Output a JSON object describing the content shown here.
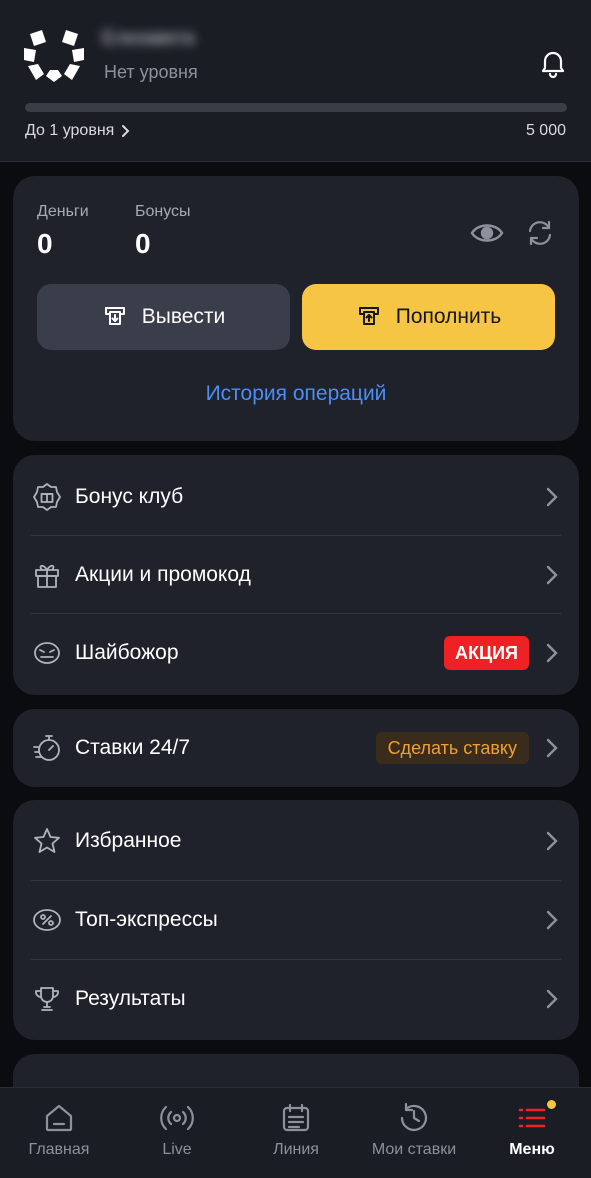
{
  "header": {
    "username": "Елизавета",
    "level_name": "Нет уровня",
    "progress_fraction": 0,
    "to_next_level": "До 1 уровня",
    "next_level_amount": "5 000"
  },
  "balance": {
    "money_label": "Деньги",
    "money_value": "0",
    "bonus_label": "Бонусы",
    "bonus_value": "0",
    "withdraw_label": "Вывести",
    "deposit_label": "Пополнить",
    "history_label": "История операций"
  },
  "menu": {
    "group1": [
      {
        "label": "Бонус клуб",
        "icon": "bonus-club-icon"
      },
      {
        "label": "Акции и промокод",
        "icon": "gift-icon"
      },
      {
        "label": "Шайбожор",
        "icon": "puck-monster-icon",
        "badge": "АКЦИЯ"
      }
    ],
    "group2": [
      {
        "label": "Ставки 24/7",
        "icon": "stopwatch-icon",
        "badge": "Сделать ставку"
      }
    ],
    "group3": [
      {
        "label": "Избранное",
        "icon": "star-icon"
      },
      {
        "label": "Топ-экспрессы",
        "icon": "express-icon"
      },
      {
        "label": "Результаты",
        "icon": "trophy-icon"
      }
    ]
  },
  "bottom_nav": [
    {
      "label": "Главная",
      "icon": "home-icon"
    },
    {
      "label": "Live",
      "icon": "live-icon"
    },
    {
      "label": "Линия",
      "icon": "calendar-icon"
    },
    {
      "label": "Мои ставки",
      "icon": "history-icon"
    },
    {
      "label": "Меню",
      "icon": "menu-icon",
      "active": true
    }
  ],
  "colors": {
    "accent_yellow": "#f7c544",
    "link_blue": "#4b8df4",
    "badge_red": "#ee2225",
    "badge_orange_text": "#f0a030",
    "card_bg": "#1f222b",
    "page_bg": "#0b0c10"
  }
}
